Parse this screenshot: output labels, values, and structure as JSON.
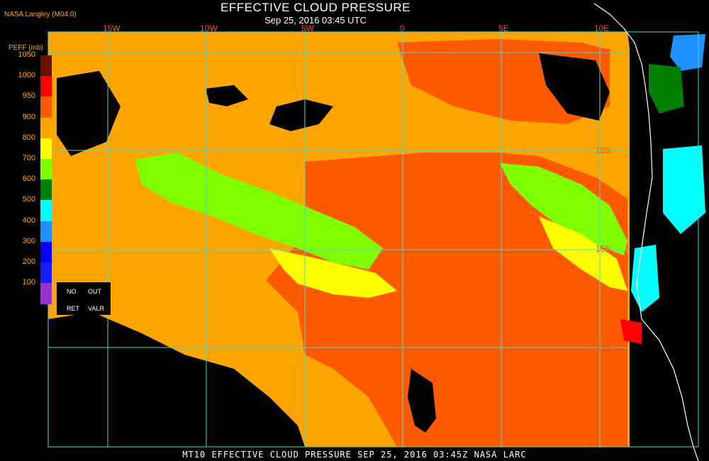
{
  "header": {
    "title": "EFFECTIVE CLOUD PRESSURE",
    "subtitle": "Sep 25, 2016 03:45 UTC",
    "credit": "NASA Langley (M04.0)"
  },
  "axes": {
    "longitude_labels": [
      "15W",
      "10W",
      "5W",
      "0",
      "5E",
      "10E"
    ],
    "latitude_labels": [
      "5S",
      "10S",
      "15S",
      "20S"
    ]
  },
  "colorbar": {
    "unit_label": "PEFF (mb)",
    "ticks": [
      "1050",
      "1000",
      "950",
      "900",
      "800",
      "700",
      "600",
      "500",
      "400",
      "300",
      "200",
      "100"
    ],
    "colors": [
      "#6b0e00",
      "#ff0000",
      "#ff5a00",
      "#ffa500",
      "#ffff00",
      "#7fff00",
      "#008000",
      "#00ffff",
      "#1e90ff",
      "#0000ff",
      "#1a1aff",
      "#9932cc"
    ],
    "legend": {
      "no_label": "NO",
      "out_label": "OUT",
      "ret_label": "RET",
      "valr_label": "VALR"
    }
  },
  "map_colors": {
    "low_cloud": "#ffa500",
    "red_orange": "#ff5a00",
    "yellow": "#ffff00",
    "green": "#7fff00",
    "cyan": "#00ffff",
    "no_retrieval": "#000000",
    "grid": "#40e0d0",
    "coastline": "#ffffff"
  },
  "footer": {
    "text": "MT10  EFFECTIVE CLOUD PRESSURE  SEP 25, 2016 03:45Z  NASA LARC"
  }
}
